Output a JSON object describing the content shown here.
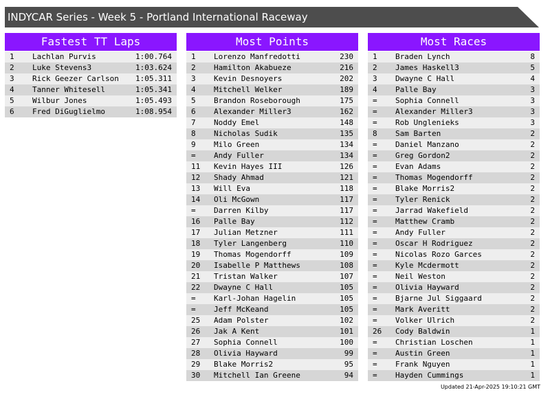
{
  "header": {
    "title": "INDYCAR Series - Week 5 - Portland International Raceway"
  },
  "panels": {
    "tt": {
      "title": "Fastest TT Laps",
      "rows": [
        {
          "pos": "1",
          "name": "Lachlan Purvis",
          "value": "1:00.764"
        },
        {
          "pos": "2",
          "name": "Luke Stevens3",
          "value": "1:03.624"
        },
        {
          "pos": "3",
          "name": "Rick Geezer Carlson",
          "value": "1:05.311"
        },
        {
          "pos": "4",
          "name": "Tanner Whitesell",
          "value": "1:05.341"
        },
        {
          "pos": "5",
          "name": "Wilbur Jones",
          "value": "1:05.493"
        },
        {
          "pos": "6",
          "name": "Fred DiGuglielmo",
          "value": "1:08.954"
        }
      ]
    },
    "points": {
      "title": "Most Points",
      "rows": [
        {
          "pos": "1",
          "name": "Lorenzo Manfredotti",
          "value": "230"
        },
        {
          "pos": "2",
          "name": "Hamilton Akabueze",
          "value": "216"
        },
        {
          "pos": "3",
          "name": "Kevin Desnoyers",
          "value": "202"
        },
        {
          "pos": "4",
          "name": "Mitchell Welker",
          "value": "189"
        },
        {
          "pos": "5",
          "name": "Brandon Roseborough",
          "value": "175"
        },
        {
          "pos": "6",
          "name": "Alexander Miller3",
          "value": "162"
        },
        {
          "pos": "7",
          "name": "Noddy Emel",
          "value": "148"
        },
        {
          "pos": "8",
          "name": "Nicholas Sudik",
          "value": "135"
        },
        {
          "pos": "9",
          "name": "Milo Green",
          "value": "134"
        },
        {
          "pos": "=",
          "name": "Andy Fuller",
          "value": "134"
        },
        {
          "pos": "11",
          "name": "Kevin Hayes III",
          "value": "126"
        },
        {
          "pos": "12",
          "name": "Shady Ahmad",
          "value": "121"
        },
        {
          "pos": "13",
          "name": "Will Eva",
          "value": "118"
        },
        {
          "pos": "14",
          "name": "Oli McGown",
          "value": "117"
        },
        {
          "pos": "=",
          "name": "Darren Kilby",
          "value": "117"
        },
        {
          "pos": "16",
          "name": "Palle Bay",
          "value": "112"
        },
        {
          "pos": "17",
          "name": "Julian Metzner",
          "value": "111"
        },
        {
          "pos": "18",
          "name": "Tyler Langenberg",
          "value": "110"
        },
        {
          "pos": "19",
          "name": "Thomas Mogendorff",
          "value": "109"
        },
        {
          "pos": "20",
          "name": "Isabelle P Matthews",
          "value": "108"
        },
        {
          "pos": "21",
          "name": "Tristan Walker",
          "value": "107"
        },
        {
          "pos": "22",
          "name": "Dwayne C Hall",
          "value": "105"
        },
        {
          "pos": "=",
          "name": "Karl-Johan Hagelin",
          "value": "105"
        },
        {
          "pos": "=",
          "name": "Jeff McKeand",
          "value": "105"
        },
        {
          "pos": "25",
          "name": "Adam Polster",
          "value": "102"
        },
        {
          "pos": "26",
          "name": "Jak A Kent",
          "value": "101"
        },
        {
          "pos": "27",
          "name": "Sophia Connell",
          "value": "100"
        },
        {
          "pos": "28",
          "name": "Olivia Hayward",
          "value": "99"
        },
        {
          "pos": "29",
          "name": "Blake Morris2",
          "value": "95"
        },
        {
          "pos": "30",
          "name": "Mitchell Ian Greene",
          "value": "94"
        }
      ]
    },
    "races": {
      "title": "Most Races",
      "rows": [
        {
          "pos": "1",
          "name": "Braden Lynch",
          "value": "8"
        },
        {
          "pos": "2",
          "name": "James Haskell3",
          "value": "5"
        },
        {
          "pos": "3",
          "name": "Dwayne C Hall",
          "value": "4"
        },
        {
          "pos": "4",
          "name": "Palle Bay",
          "value": "3"
        },
        {
          "pos": "=",
          "name": "Sophia Connell",
          "value": "3"
        },
        {
          "pos": "=",
          "name": "Alexander Miller3",
          "value": "3"
        },
        {
          "pos": "=",
          "name": "Rob Unglenieks",
          "value": "3"
        },
        {
          "pos": "8",
          "name": "Sam Barten",
          "value": "2"
        },
        {
          "pos": "=",
          "name": "Daniel Manzano",
          "value": "2"
        },
        {
          "pos": "=",
          "name": "Greg Gordon2",
          "value": "2"
        },
        {
          "pos": "=",
          "name": "Evan Adams",
          "value": "2"
        },
        {
          "pos": "=",
          "name": "Thomas Mogendorff",
          "value": "2"
        },
        {
          "pos": "=",
          "name": "Blake Morris2",
          "value": "2"
        },
        {
          "pos": "=",
          "name": "Tyler Renick",
          "value": "2"
        },
        {
          "pos": "=",
          "name": "Jarrad Wakefield",
          "value": "2"
        },
        {
          "pos": "=",
          "name": "Matthew Cramb",
          "value": "2"
        },
        {
          "pos": "=",
          "name": "Andy Fuller",
          "value": "2"
        },
        {
          "pos": "=",
          "name": "Oscar H Rodriguez",
          "value": "2"
        },
        {
          "pos": "=",
          "name": "Nicolas Rozo Garces",
          "value": "2"
        },
        {
          "pos": "=",
          "name": "Kyle Mcdermott",
          "value": "2"
        },
        {
          "pos": "=",
          "name": "Neil Weston",
          "value": "2"
        },
        {
          "pos": "=",
          "name": "Olivia Hayward",
          "value": "2"
        },
        {
          "pos": "=",
          "name": "Bjarne Jul Siggaard",
          "value": "2"
        },
        {
          "pos": "=",
          "name": "Mark Averitt",
          "value": "2"
        },
        {
          "pos": "=",
          "name": "Volker Ulrich",
          "value": "2"
        },
        {
          "pos": "26",
          "name": "Cody Baldwin",
          "value": "1"
        },
        {
          "pos": "=",
          "name": "Christian Loschen",
          "value": "1"
        },
        {
          "pos": "=",
          "name": "Austin Green",
          "value": "1"
        },
        {
          "pos": "=",
          "name": "Frank Nguyen",
          "value": "1"
        },
        {
          "pos": "=",
          "name": "Hayden Cummings",
          "value": "1"
        }
      ]
    }
  },
  "footer": {
    "updated": "Updated 21-Apr-2025 19:10:21 GMT"
  },
  "colors": {
    "banner": "#4d4d4d",
    "panel_header": "#8a16ff",
    "row_light": "#eeeeee",
    "row_dark": "#d6d6d6"
  }
}
